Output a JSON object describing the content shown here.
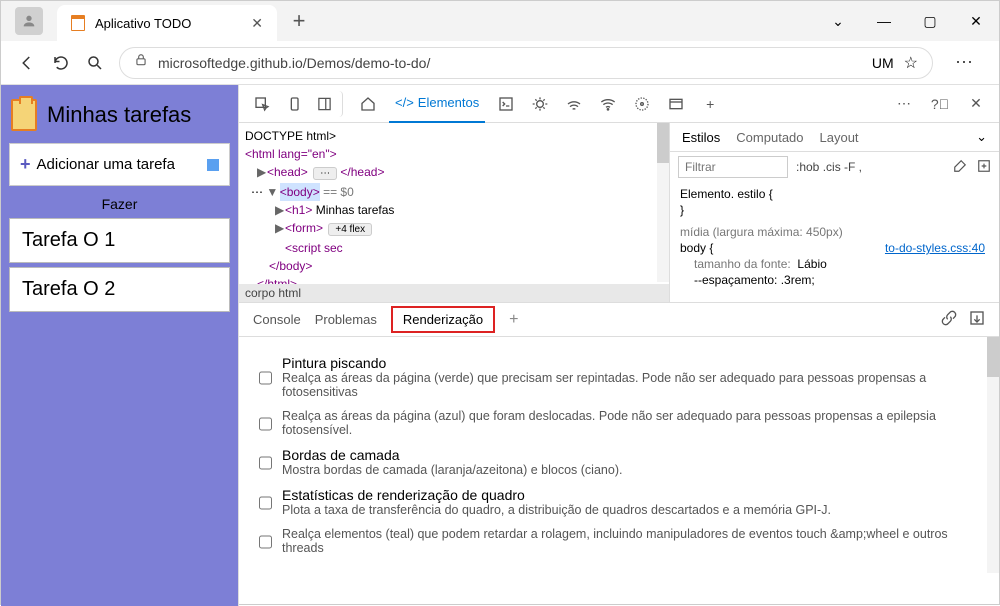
{
  "window": {
    "tab_title": "Aplicativo TODO",
    "url": "microsoftedge.github.io/Demos/demo-to-do/",
    "profile_badge": "UM"
  },
  "page": {
    "title": "Minhas tarefas",
    "add_label": "Adicionar uma tarefa",
    "section": "Fazer",
    "tasks": [
      "Tarefa O 1",
      "Tarefa O 2"
    ]
  },
  "devtools": {
    "elements_tab": "Elementos",
    "html": {
      "doctype": "DOCTYPE html>",
      "html_open": "<html lang=\"en\">",
      "head": "<head>",
      "head_dots": "⋯",
      "head_close": "</head>",
      "body_open": "<body>",
      "body_eq": "== $0",
      "h1": "<h1>",
      "h1_text": "Minhas tarefas",
      "form": "<form>",
      "form_badge": "+4 flex",
      "script": "<script sec",
      "body_close": "</body>",
      "html_close": "</html>",
      "breadcrumb": "corpo html"
    },
    "styles": {
      "tab_styles": "Estilos",
      "tab_computed": "Computado",
      "tab_layout": "Layout",
      "filter_placeholder": "Filtrar",
      "hov_cls": ":hob .cis  -F  ,",
      "element_style": "Elemento. estilo {",
      "close_brace": "}",
      "media": "mídia (largura máxima: 450px)",
      "body_rule": "body {",
      "font_size": "tamanho da fonte:",
      "font_val": "Lábio",
      "spacing": "--espaçamento:",
      "spacing_val": ".3rem;",
      "link": "to-do-styles.css:40"
    },
    "drawer": {
      "console": "Console",
      "problems": "Problemas",
      "rendering": "Renderização",
      "options": [
        {
          "title": "Pintura piscando",
          "desc": "Realça as áreas da página (verde) que precisam ser repintadas. Pode não ser adequado para pessoas propensas a fotosensitivas"
        },
        {
          "title": "",
          "desc": "Realça as áreas da página (azul) que foram deslocadas. Pode não ser adequado para pessoas propensas a epilepsia fotosensível."
        },
        {
          "title": "Bordas de camada",
          "desc": "Mostra bordas de camada (laranja/azeitona) e blocos (ciano)."
        },
        {
          "title": "Estatísticas de renderização de quadro",
          "desc": "Plota a taxa de transferência do quadro, a distribuição de quadros descartados e a memória GPI-J."
        },
        {
          "title": "",
          "desc": "Realça elementos (teal) que podem retardar a rolagem, incluindo manipuladores de eventos touch &amp;wheel e outros threads"
        }
      ]
    }
  }
}
